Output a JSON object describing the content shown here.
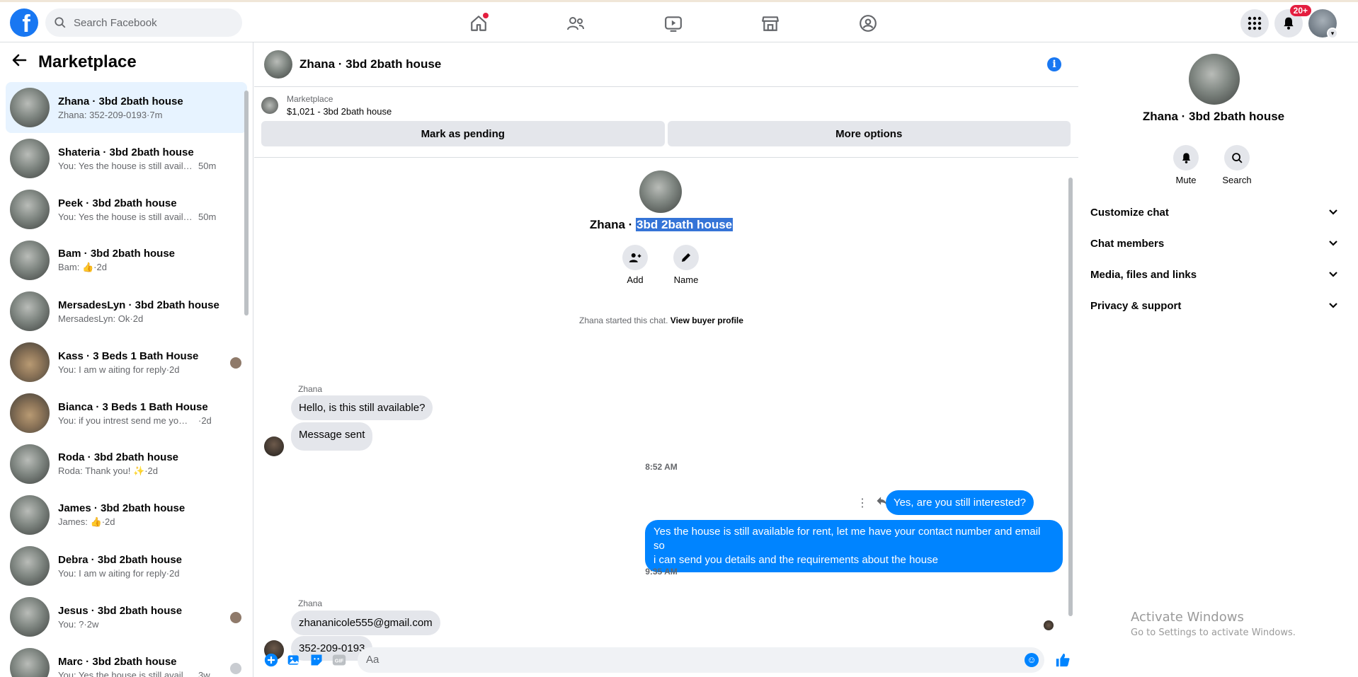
{
  "topbar": {
    "logo": "f",
    "search_placeholder": "Search Facebook",
    "notifications_badge": "20+"
  },
  "sidebar": {
    "title": "Marketplace",
    "conversations": [
      {
        "name": "Zhana · 3bd 2bath house",
        "preview": "Zhana: 352-209-0193",
        "time": "·7m"
      },
      {
        "name": "Shateria · 3bd 2bath house",
        "preview": "You: Yes the house is still availabl...",
        "time": "50m"
      },
      {
        "name": "Peek · 3bd 2bath house",
        "preview": "You: Yes the house is still availabl...",
        "time": "50m"
      },
      {
        "name": "Bam · 3bd 2bath house",
        "preview": "Bam: 👍",
        "time": "·2d"
      },
      {
        "name": "MersadesLyn · 3bd 2bath house",
        "preview": "MersadesLyn: Ok",
        "time": "·2d"
      },
      {
        "name": "Kass · 3 Beds 1 Bath House",
        "preview": "You: I am w aiting for reply",
        "time": "·2d"
      },
      {
        "name": "Bianca · 3 Beds 1 Bath House",
        "preview": "You: if you intrest send me your co...",
        "time": "·2d"
      },
      {
        "name": "Roda · 3bd 2bath house",
        "preview": "Roda: Thank you! ✨",
        "time": "·2d"
      },
      {
        "name": "James · 3bd 2bath house",
        "preview": "James: 👍",
        "time": "·2d"
      },
      {
        "name": "Debra · 3bd 2bath house",
        "preview": "You: I am w aiting for reply",
        "time": "·2d"
      },
      {
        "name": "Jesus · 3bd 2bath house",
        "preview": "You: ?",
        "time": "·2w"
      },
      {
        "name": "Marc · 3bd 2bath house",
        "preview": "You: Yes the house is still availab...",
        "time": "3w"
      }
    ]
  },
  "chat": {
    "header_title": "Zhana · 3bd 2bath house",
    "listing_source": "Marketplace",
    "listing_title": "$1,021 - 3bd 2bath house",
    "mark_pending_label": "Mark as pending",
    "more_options_label": "More options",
    "intro_name": "Zhana · ",
    "intro_highlight": "3bd 2bath house",
    "add_label": "Add",
    "name_label": "Name",
    "started_text": "Zhana started this chat.",
    "view_profile": "View buyer profile",
    "sender_1": "Zhana",
    "msg_1": "Hello, is this still available?",
    "msg_2": "Message sent",
    "time_1": "8:52 AM",
    "msg_3": "Yes, are you still interested?",
    "msg_4a": "Yes the house is still available for rent, let me have your contact number and email so",
    "msg_4b": "i can send you details and the requirements about the house",
    "time_2": "9:35 AM",
    "sender_2": "Zhana",
    "msg_5": "zhananicole555@gmail.com",
    "msg_6": "352-209-0193",
    "composer_placeholder": "Aa"
  },
  "details": {
    "title": "Zhana · 3bd 2bath house",
    "mute_label": "Mute",
    "search_label": "Search",
    "sections": [
      "Customize chat",
      "Chat members",
      "Media, files and links",
      "Privacy & support"
    ]
  },
  "watermark": {
    "line1": "Activate Windows",
    "line2": "Go to Settings to activate Windows."
  },
  "colors": {
    "brand": "#1877f2",
    "outgoing_bubble": "#0084ff",
    "incoming_bubble": "#e4e6eb",
    "active_row": "#e7f3ff"
  }
}
